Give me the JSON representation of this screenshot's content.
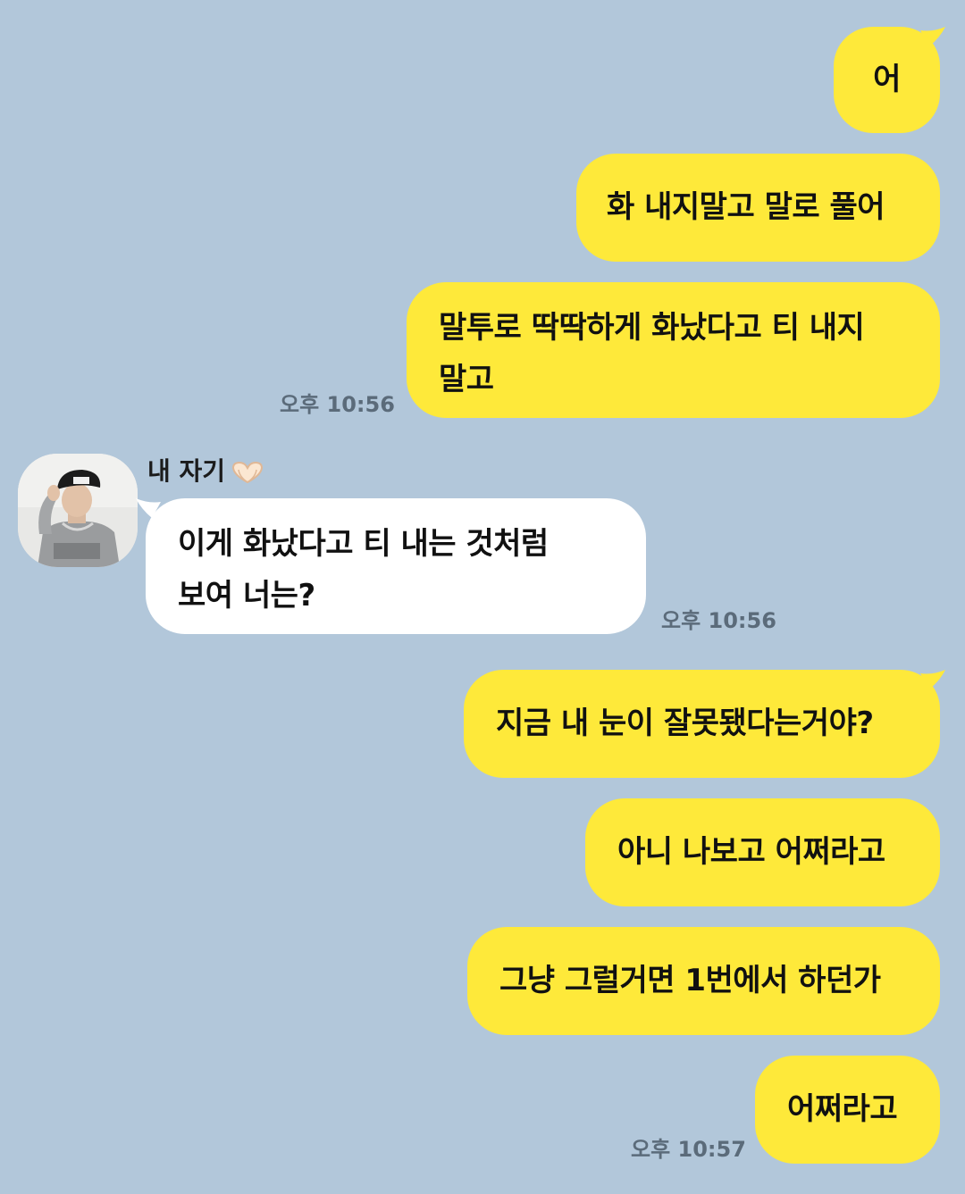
{
  "colors": {
    "background": "#b2c7da",
    "my_bubble": "#fee93a",
    "their_bubble": "#ffffff",
    "timestamp": "#5b6b7a"
  },
  "contact": {
    "name": "내 자기",
    "name_emoji_icon": "heart-hands-icon",
    "avatar_icon": "profile-photo"
  },
  "messages": [
    {
      "from": "me",
      "lines": [
        "어"
      ]
    },
    {
      "from": "me",
      "lines": [
        "화 내지말고 말로 풀어"
      ]
    },
    {
      "from": "me",
      "lines": [
        "말투로 딱딱하게 화났다고 티 내지",
        "말고"
      ],
      "time": "오후 10:56"
    },
    {
      "from": "contact",
      "lines": [
        "이게 화났다고 티 내는 것처럼",
        "보여 너는?"
      ],
      "time": "오후 10:56"
    },
    {
      "from": "me",
      "lines": [
        "지금 내 눈이 잘못됐다는거야?"
      ]
    },
    {
      "from": "me",
      "lines": [
        "아니 나보고 어쩌라고"
      ]
    },
    {
      "from": "me",
      "lines": [
        "그냥 그럴거면 1번에서 하던가"
      ]
    },
    {
      "from": "me",
      "lines": [
        "어쩌라고"
      ],
      "time": "오후 10:57"
    }
  ]
}
